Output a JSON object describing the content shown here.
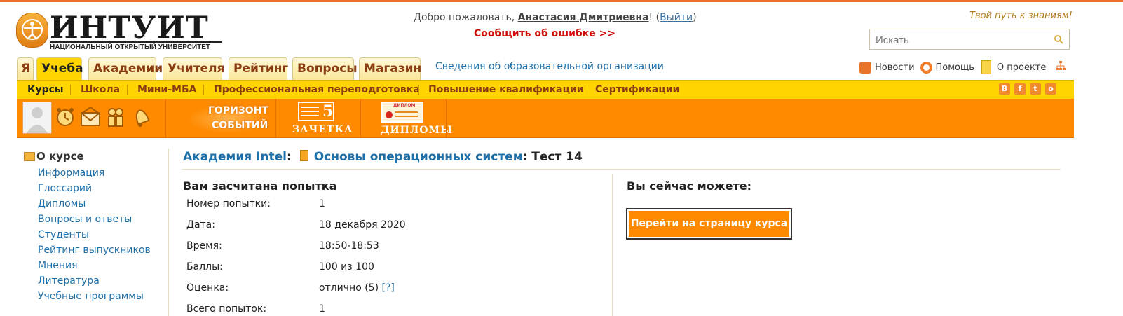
{
  "logo": {
    "text": "ИНТУИТ",
    "subtitle": "НАЦИОНАЛЬНЫЙ ОТКРЫТЫЙ УНИВЕРСИТЕТ"
  },
  "header": {
    "welcome_prefix": "Добро пожаловать, ",
    "user_name": "Анастасия Дмитриевна",
    "welcome_suffix": "! (",
    "logout": "Выйти",
    "close_paren": ")",
    "report_error": "Сообщить об ошибке >>",
    "slogan": "Твой путь к знаниям!",
    "search_placeholder": "Искать"
  },
  "tabs": [
    {
      "label": "Я",
      "active": false
    },
    {
      "label": "Учеба",
      "active": true
    },
    {
      "label": "Академии",
      "active": false
    },
    {
      "label": "Учителя",
      "active": false
    },
    {
      "label": "Рейтинг",
      "active": false
    },
    {
      "label": "Вопросы",
      "active": false
    },
    {
      "label": "Магазин",
      "active": false
    }
  ],
  "org_info_link": "Сведения об образовательной организации",
  "right_links": {
    "news": "Новости",
    "help": "Помощь",
    "about": "О проекте"
  },
  "subnav": [
    {
      "label": "Курсы",
      "active": true
    },
    {
      "label": "Школа",
      "active": false
    },
    {
      "label": "Мини-МБА",
      "active": false
    },
    {
      "label": "Профессиональная переподготовка",
      "active": false
    },
    {
      "label": "Повышение квалификации",
      "active": false
    },
    {
      "label": "Сертификации",
      "active": false
    }
  ],
  "social": [
    "В",
    "f",
    "t",
    "о"
  ],
  "bar": {
    "horizon_line1": "ГОРИЗОНТ",
    "horizon_line2": "СОБЫТИЙ",
    "zachetka": "ЗАЧЕТКА",
    "zachetka_grade": "5",
    "diplomy": "ДИПЛОМЫ",
    "diploma_badge": "ДИПЛОМ"
  },
  "sidebar": {
    "title": "О курсе",
    "items": [
      "Информация",
      "Глоссарий",
      "Дипломы",
      "Вопросы и ответы",
      "Студенты",
      "Рейтинг выпускников",
      "Мнения",
      "Литература",
      "Учебные программы"
    ]
  },
  "breadcrumb": {
    "academy": "Академия Intel",
    "sep": ": ",
    "course": "Основы операционных систем",
    "test": ": Тест 14"
  },
  "attempt": {
    "heading": "Вам засчитана попытка",
    "rows": [
      {
        "label": "Номер попытки:",
        "value": "1"
      },
      {
        "label": "Дата:",
        "value": "18 декабря 2020"
      },
      {
        "label": "Время:",
        "value": "18:50-18:53"
      },
      {
        "label": "Баллы:",
        "value": "100 из 100"
      },
      {
        "label": "Оценка:",
        "value": "отлично (5)"
      },
      {
        "label": "Всего попыток:",
        "value": "1"
      }
    ],
    "help_link": "[?]"
  },
  "actions": {
    "heading": "Вы сейчас можете:",
    "goto_course": "Перейти на страницу курса"
  },
  "colors": {
    "orange": "#ff8a00",
    "yellow": "#ffd400",
    "link": "#1f6fa8",
    "red": "#d10c0c"
  }
}
